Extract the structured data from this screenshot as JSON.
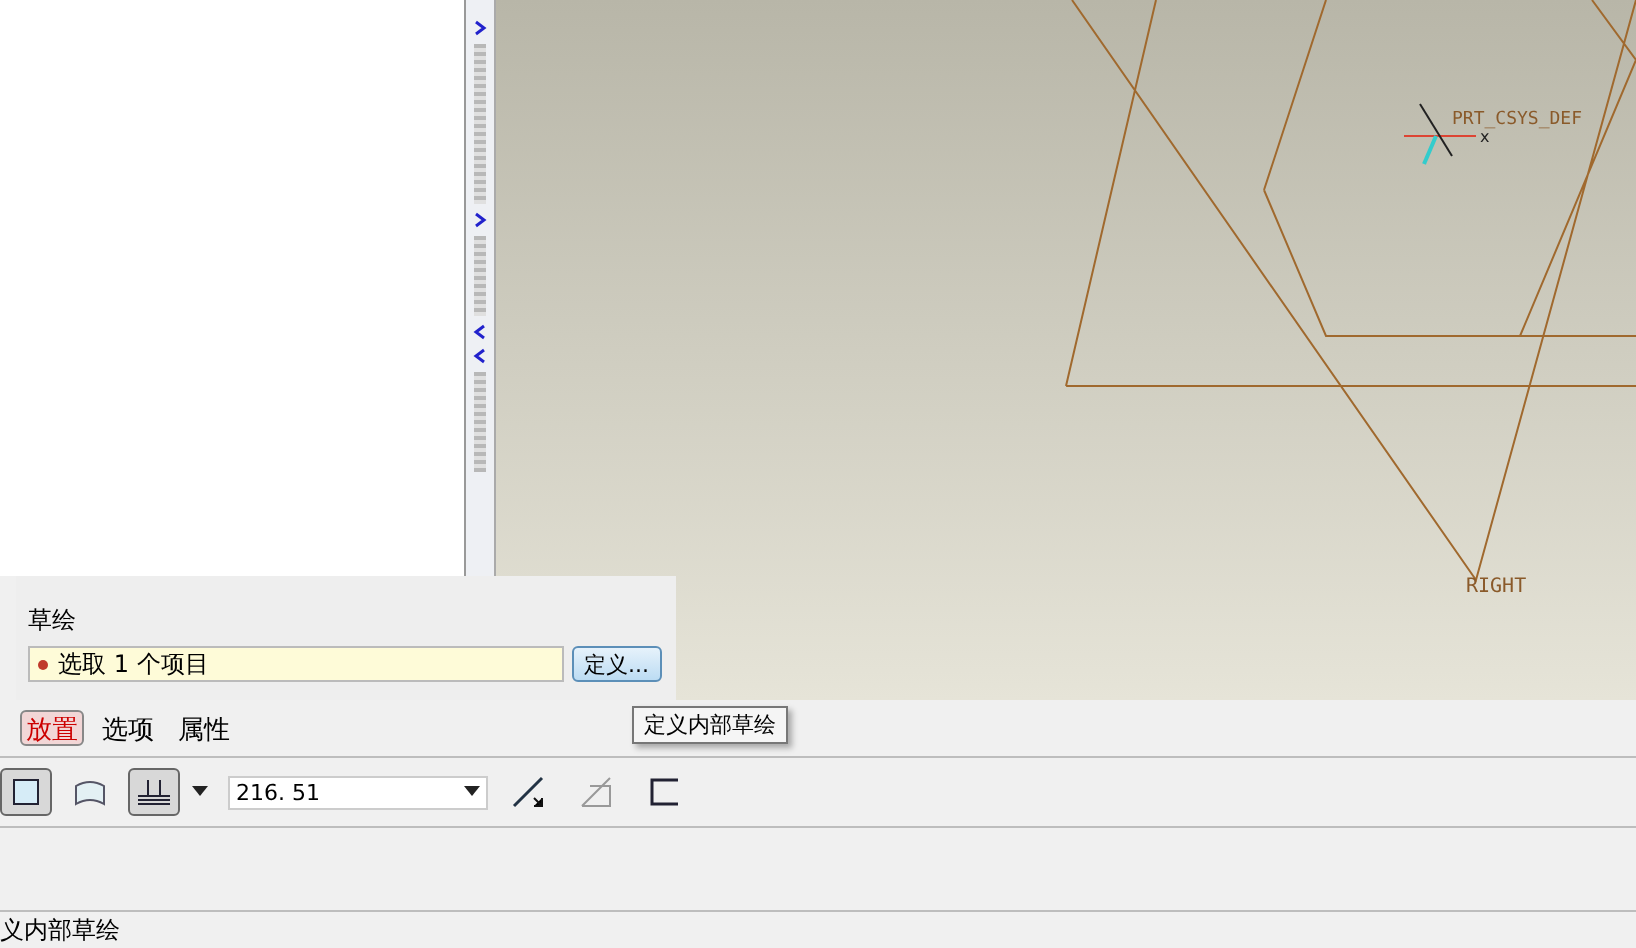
{
  "viewport": {
    "csys_label": "PRT_CSYS_DEF",
    "axis_label": "x",
    "plane_label": "RIGHT"
  },
  "sketch_panel": {
    "title": "草绘",
    "collector": "选取 1 个项目",
    "define_button": "定义..."
  },
  "tooltip": "定义内部草绘",
  "tabs": [
    {
      "label": "放置",
      "selected": true
    },
    {
      "label": "选项",
      "selected": false
    },
    {
      "label": "属性",
      "selected": false
    }
  ],
  "toolbar": {
    "tools": [
      {
        "kind": "solid",
        "pressed": true
      },
      {
        "kind": "surface",
        "pressed": false
      },
      {
        "kind": "depth",
        "pressed": true
      }
    ],
    "depth_value": "216. 51"
  },
  "status_bar": {
    "message": "义内部草绘"
  }
}
